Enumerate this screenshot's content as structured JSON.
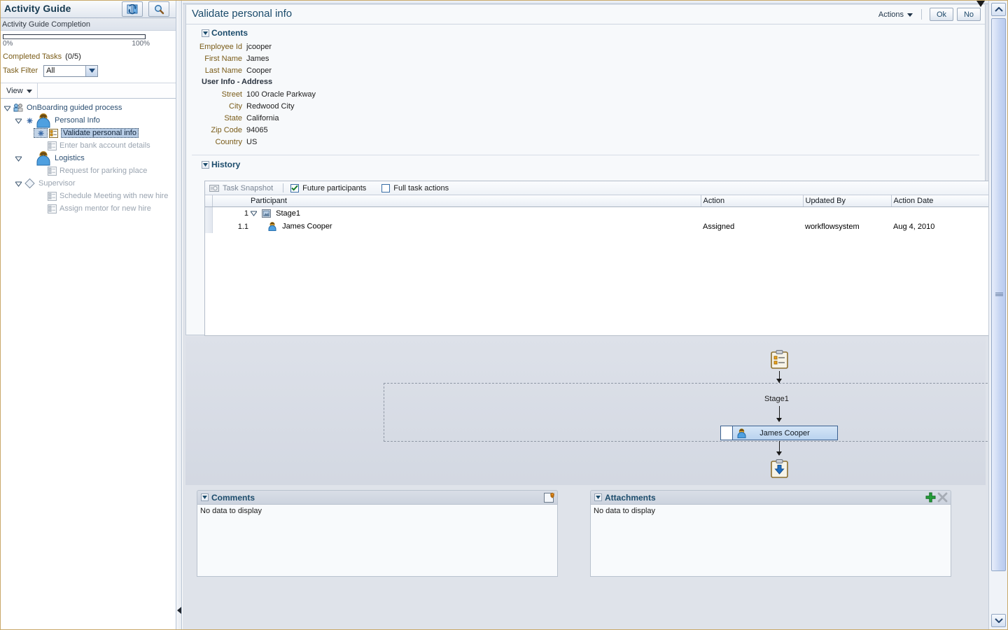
{
  "activity_guide": {
    "title": "Activity Guide",
    "refresh_icon": "refresh-icon",
    "search_icon": "search-icon",
    "completion_label": "Activity Guide Completion",
    "progress": {
      "percent": 0,
      "min_label": "0%",
      "max_label": "100%"
    },
    "completed_tasks_label": "Completed Tasks",
    "completed_tasks_value": "(0/5)",
    "task_filter_label": "Task Filter",
    "task_filter_value": "All",
    "task_filter_options": [
      "All"
    ],
    "view_menu_label": "View",
    "tree": {
      "root": {
        "label": "OnBoarding guided process",
        "icon": "process-icon",
        "expanded": true
      },
      "groups": [
        {
          "label": "Personal Info",
          "icon": "user-icon",
          "expanded": true,
          "marker": "asterisk-icon",
          "children": [
            {
              "label": "Validate personal info",
              "icon": "task-icon",
              "selected": true,
              "marker": "asterisk-icon"
            },
            {
              "label": "Enter bank account details",
              "icon": "task-icon",
              "selected": false
            }
          ]
        },
        {
          "label": "Logistics",
          "icon": "user-icon",
          "expanded": true,
          "children": [
            {
              "label": "Request for parking place",
              "icon": "task-icon",
              "selected": false
            }
          ]
        },
        {
          "label": "Supervisor",
          "icon": "diamond-icon",
          "expanded": true,
          "children": [
            {
              "label": "Schedule Meeting with new hire",
              "icon": "task-icon",
              "selected": false
            },
            {
              "label": "Assign mentor for new hire",
              "icon": "task-icon",
              "selected": false
            }
          ]
        }
      ]
    }
  },
  "task": {
    "title": "Validate personal info",
    "actions_label": "Actions",
    "ok_label": "Ok",
    "no_label": "No",
    "contents": {
      "section_title": "Contents",
      "fields": [
        {
          "label": "Employee Id",
          "value": "jcooper"
        },
        {
          "label": "First Name",
          "value": "James"
        },
        {
          "label": "Last Name",
          "value": "Cooper"
        }
      ],
      "group_title": "User Info - Address",
      "address_fields": [
        {
          "label": "Street",
          "value": "100 Oracle Parkway"
        },
        {
          "label": "City",
          "value": "Redwood City"
        },
        {
          "label": "State",
          "value": "California"
        },
        {
          "label": "Zip Code",
          "value": "94065"
        },
        {
          "label": "Country",
          "value": "US"
        }
      ]
    },
    "history": {
      "section_title": "History",
      "toolbar": {
        "task_snapshot_label": "Task Snapshot",
        "task_snapshot_icon": "camera-icon",
        "future_participants_label": "Future participants",
        "future_participants_checked": true,
        "full_task_actions_label": "Full task actions",
        "full_task_actions_checked": false
      },
      "columns": [
        "Participant",
        "Action",
        "Updated By",
        "Action Date"
      ],
      "rows": [
        {
          "num": "1",
          "participant": "Stage1",
          "icon": "stage-icon",
          "expanded": true,
          "action": "",
          "updated_by": "",
          "action_date": "",
          "level": 0
        },
        {
          "num": "1.1",
          "participant": "James Cooper",
          "icon": "user-small-icon",
          "action": "Assigned",
          "updated_by": "workflowsystem",
          "action_date": "Aug 4, 2010",
          "level": 1
        }
      ]
    }
  },
  "diagram": {
    "start_icon": "clipboard-start-icon",
    "end_icon": "clipboard-end-icon",
    "stage_label": "Stage1",
    "participant": {
      "label": "James Cooper",
      "icon": "user-small-icon"
    }
  },
  "comments": {
    "title": "Comments",
    "empty_text": "No data to display",
    "add_icon": "add-comment-icon"
  },
  "attachments": {
    "title": "Attachments",
    "empty_text": "No data to display",
    "add_icon": "add-icon",
    "delete_icon": "delete-icon"
  },
  "colors": {
    "accent": "#1b4b6b",
    "label_amber": "#7a5c18",
    "selection": "#b6cbe4",
    "panel_bg": "#dfe3ea"
  }
}
